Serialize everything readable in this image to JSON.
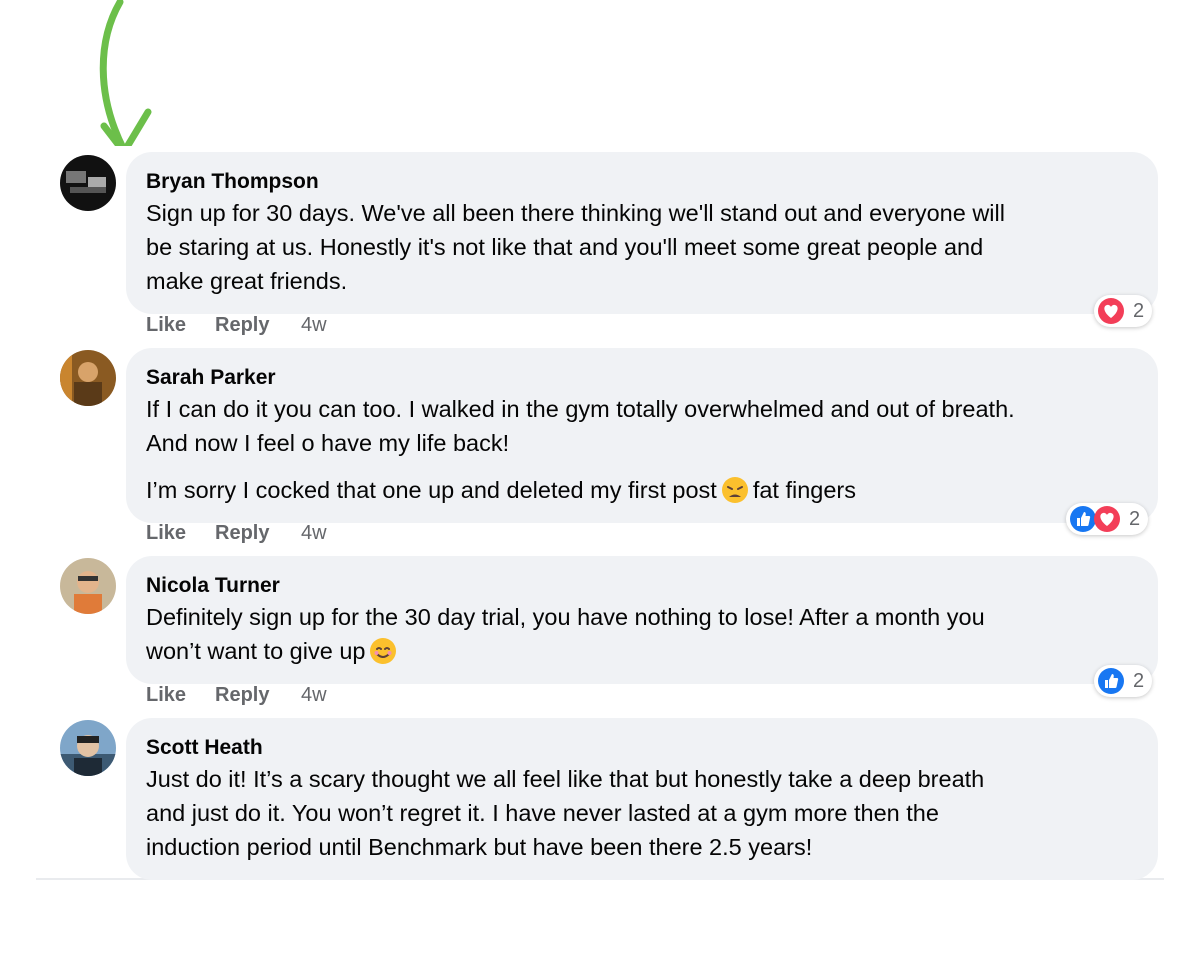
{
  "comments": [
    {
      "author": "Bryan Thompson",
      "lines": [
        "Sign up for 30 days. We've all been there thinking we'll stand out and everyone will",
        "be staring at us. Honestly it's not like that and you'll meet some great people and",
        "make great friends."
      ],
      "like_label": "Like",
      "reply_label": "Reply",
      "age": "4w",
      "reactions": [
        "heart"
      ],
      "reaction_count": "2"
    },
    {
      "author": "Sarah Parker",
      "lines": [
        "If I can do it you can too. I walked in the gym totally overwhelmed and out of breath.",
        "And now I feel o have my life back!"
      ],
      "second_paragraph_before_emoji": "I’m sorry I cocked that one up and deleted my first post",
      "second_paragraph_after_emoji": "fat fingers",
      "emoji": "weary-face",
      "like_label": "Like",
      "reply_label": "Reply",
      "age": "4w",
      "reactions": [
        "like",
        "heart"
      ],
      "reaction_count": "2"
    },
    {
      "author": "Nicola Turner",
      "lines": [
        "Definitely sign up for the 30 day trial, you have nothing to lose! After a month you"
      ],
      "last_line_before_emoji": "won’t want to give up",
      "emoji": "smiling-face",
      "like_label": "Like",
      "reply_label": "Reply",
      "age": "4w",
      "reactions": [
        "like"
      ],
      "reaction_count": "2"
    },
    {
      "author": "Scott Heath",
      "lines": [
        "Just do it! It’s a scary thought we all feel like that but honestly take a deep breath",
        "and just do it. You won’t regret it. I have never lasted at a gym more then the",
        "induction period until Benchmark but have been there 2.5 years!"
      ]
    }
  ],
  "colors": {
    "bubble": "#f0f2f5",
    "secondary_text": "#65676b",
    "like_blue": "#1877f2",
    "heart_red": "#f33e58",
    "arrow_green": "#6cbf4a"
  },
  "icons": [
    "green-arrow-icon",
    "heart-reaction-icon",
    "like-reaction-icon",
    "weary-face-emoji-icon",
    "smiling-face-emoji-icon"
  ]
}
